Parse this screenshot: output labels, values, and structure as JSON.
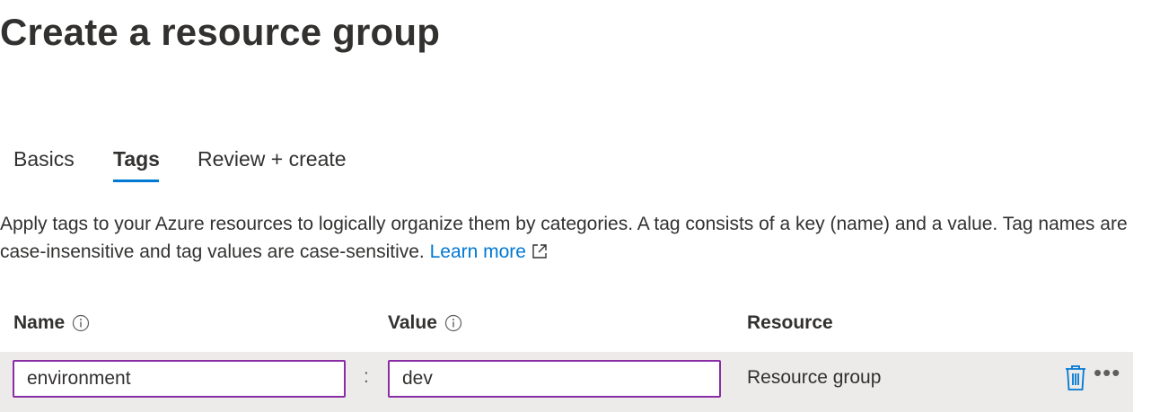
{
  "page": {
    "title": "Create a resource group"
  },
  "tabs": [
    {
      "label": "Basics",
      "active": false
    },
    {
      "label": "Tags",
      "active": true
    },
    {
      "label": "Review + create",
      "active": false
    }
  ],
  "description": {
    "text": "Apply tags to your Azure resources to logically organize them by categories. A tag consists of a key (name) and a value. Tag names are case-insensitive and tag values are case-sensitive.",
    "link_label": "Learn more",
    "link_icon": "external-link-icon"
  },
  "table": {
    "headers": {
      "name": "Name",
      "value": "Value",
      "resource": "Resource"
    },
    "rows": [
      {
        "name": "environment",
        "separator": ":",
        "value": "dev",
        "resource": "Resource group"
      }
    ]
  },
  "colors": {
    "accent": "#0078d4",
    "field_border": "#8a2da5",
    "row_background": "#edebe9",
    "text": "#323130"
  },
  "icons": {
    "info": "info-icon",
    "delete": "trash-icon",
    "more": "more-options-icon"
  }
}
